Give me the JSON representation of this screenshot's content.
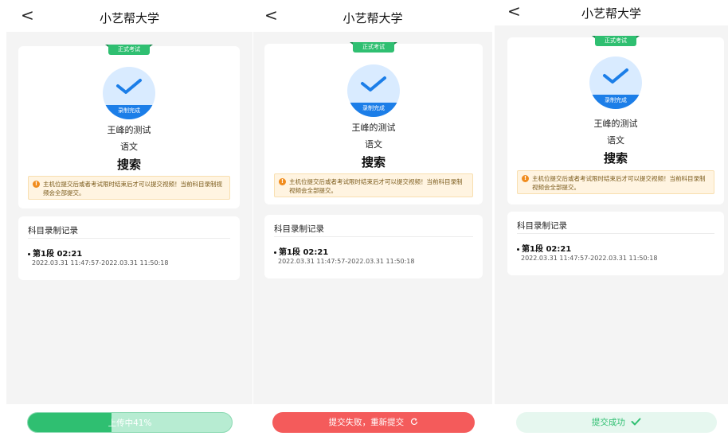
{
  "colors": {
    "accent_green": "#2fbf71",
    "check_blue": "#1c7ee8",
    "error_red": "#f45b5b",
    "notice_bg": "#fff4e1",
    "notice_icon": "#f08c1e"
  },
  "screens": [
    {
      "header": {
        "back": "<",
        "title": "小艺帮大学"
      },
      "tag": "正式考试",
      "status_badge": "录制完成",
      "exam_name": "王峰的测试",
      "subject": "语文",
      "task": "搜索",
      "notice": {
        "icon": "!",
        "text": "主机位提交后或者考试限时结束后才可以提交视频！当前科目录制视频会全部提交。"
      },
      "record": {
        "title": "科目录制记录",
        "segment": "第1段 02:21",
        "time_range": "2022.03.31 11:47:57-2022.03.31 11:50:18"
      },
      "button": {
        "label": "上传中41%",
        "progress": 0.41
      }
    },
    {
      "header": {
        "back": "<",
        "title": "小艺帮大学"
      },
      "tag": "正式考试",
      "status_badge": "录制完成",
      "exam_name": "王峰的测试",
      "subject": "语文",
      "task": "搜索",
      "notice": {
        "icon": "!",
        "text": "主机位提交后或者考试限时结束后才可以提交视频！当前科目录制视频会全部提交。"
      },
      "record": {
        "title": "科目录制记录",
        "segment": "第1段 02:21",
        "time_range": "2022.03.31 11:47:57-2022.03.31 11:50:18"
      },
      "button": {
        "label": "提交失败，重新提交",
        "icon": "refresh-icon"
      }
    },
    {
      "header": {
        "back": "<",
        "title": "小艺帮大学"
      },
      "tag": "正式考试",
      "status_badge": "录制完成",
      "exam_name": "王峰的测试",
      "subject": "语文",
      "task": "搜索",
      "notice": {
        "icon": "!",
        "text": "主机位提交后或者考试限时结束后才可以提交视频！当前科目录制视频会全部提交。"
      },
      "record": {
        "title": "科目录制记录",
        "segment": "第1段 02:21",
        "time_range": "2022.03.31 11:47:57-2022.03.31 11:50:18"
      },
      "button": {
        "label": "提交成功",
        "icon": "check-icon"
      }
    }
  ]
}
